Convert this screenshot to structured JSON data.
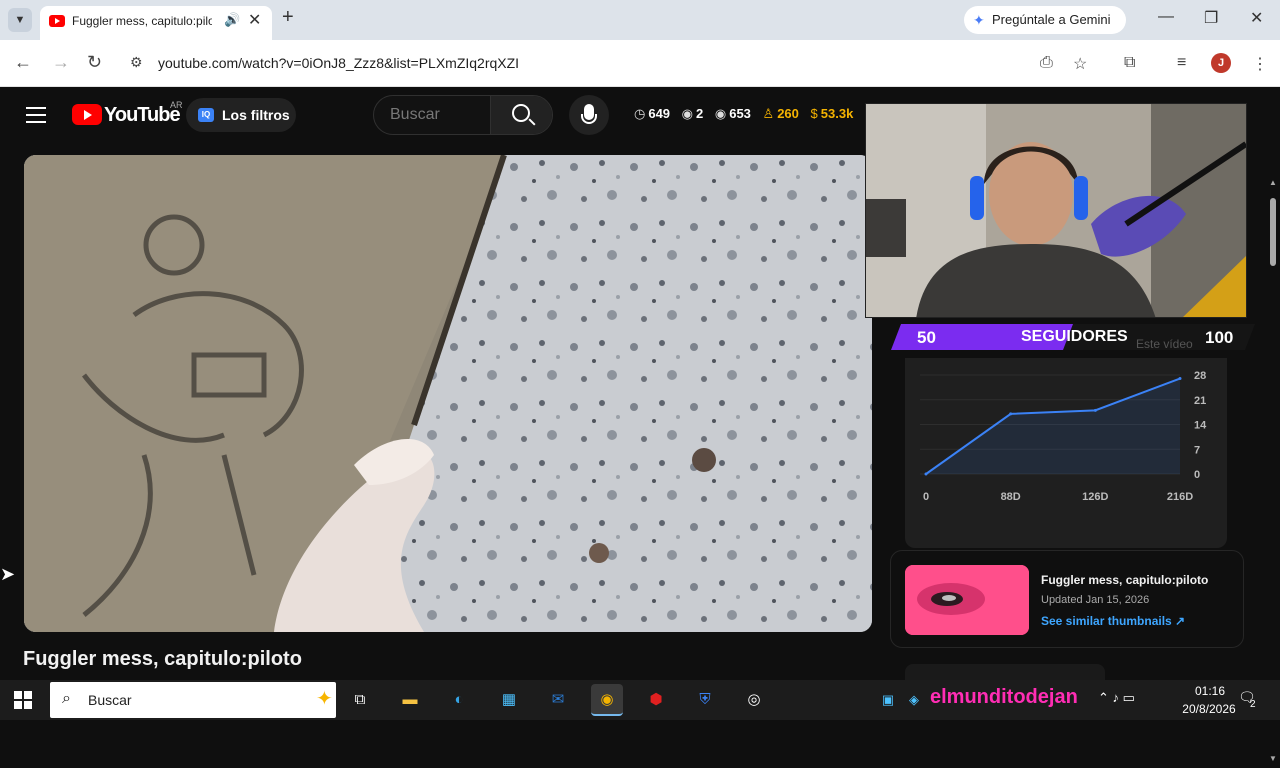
{
  "browser": {
    "tab_title": "Fuggler mess, capitulo:pilot",
    "tab_audio_icon": "speaker-icon",
    "url": "youtube.com/watch?v=0iOnJ8_Zzz8&list=PLXmZIq2rqXZI",
    "gemini_label": "Pregúntale a Gemini",
    "profile_initial": "J"
  },
  "youtube": {
    "logo_text": "YouTube",
    "region_code": "AR",
    "filtros_icon_text": "IQ",
    "filtros_label": "Los filtros",
    "search_placeholder": "Buscar",
    "stats": {
      "views_total": "649",
      "watching": "2",
      "views_alt": "653",
      "users": "260",
      "earnings": "53.3k"
    },
    "video_title": "Fuggler mess, capitulo:piloto"
  },
  "overlay": {
    "followers_start": "50",
    "followers_label": "SEGUIDORES",
    "followers_goal": "100",
    "followers_progress_fraction": 0.5,
    "hidden_text": "Este vídeo"
  },
  "chart_data": {
    "type": "line",
    "x": [
      "0",
      "88D",
      "126D",
      "216D"
    ],
    "values": [
      0,
      17,
      18,
      27
    ],
    "yticks": [
      0,
      7,
      14,
      21,
      28
    ],
    "ylim": [
      0,
      28
    ],
    "grid": true,
    "line_color": "#3b82f6"
  },
  "related": {
    "title": "Fuggler mess, capitulo:piloto",
    "updated": "Updated Jan 15, 2026",
    "similar_label": "See similar thumbnails ↗"
  },
  "taskbar": {
    "search_label": "Buscar",
    "brand_text": "elmunditodejan",
    "time": "01:16",
    "date": "20/8/2026",
    "notifications": "2"
  }
}
